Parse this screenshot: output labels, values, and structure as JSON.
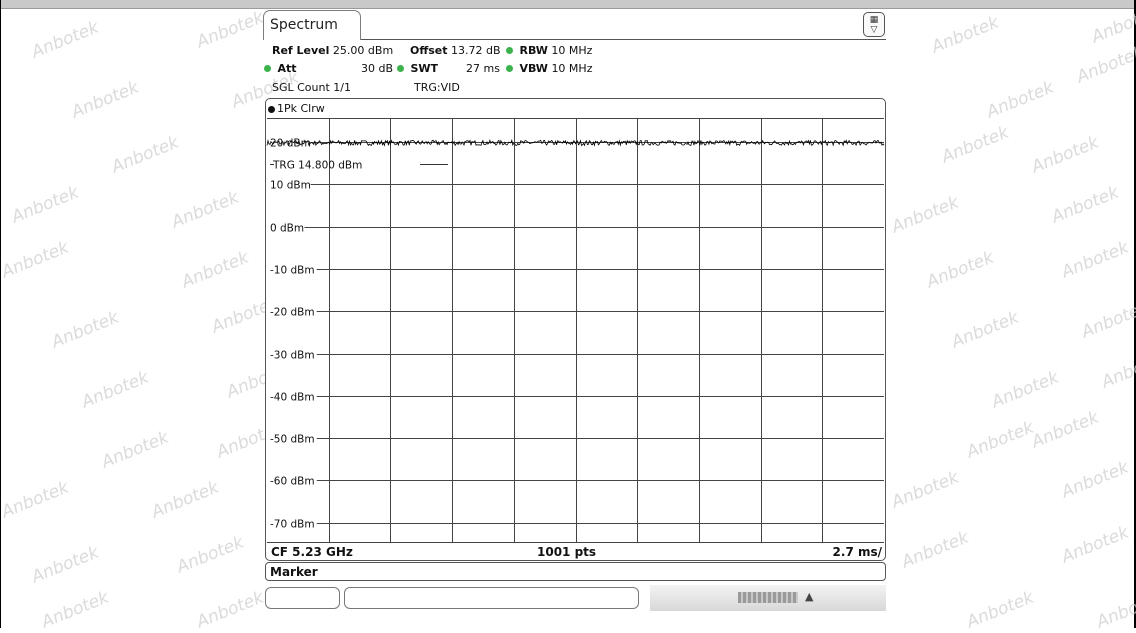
{
  "watermark_text": "Anbotek",
  "tab": {
    "label": "Spectrum"
  },
  "settings": {
    "ref_level_label": "Ref Level",
    "ref_level_value": "25.00 dBm",
    "offset_label": "Offset",
    "offset_value": "13.72 dB",
    "rbw_label": "RBW",
    "rbw_value": "10 MHz",
    "att_label": "Att",
    "att_value": "30 dB",
    "swt_label": "SWT",
    "swt_value": "27 ms",
    "vbw_label": "VBW",
    "vbw_value": "10 MHz",
    "sgl_count": "SGL Count 1/1",
    "trg": "TRG:VID"
  },
  "trace_label": "1Pk Clrw",
  "chart_data": {
    "type": "line",
    "ylim": [
      -80,
      25
    ],
    "y_ticks": [
      20,
      10,
      0,
      -10,
      -20,
      -30,
      -40,
      -50,
      -60,
      -70
    ],
    "y_tick_labels": [
      "20 dBm",
      "10 dBm",
      "0 dBm",
      "-10 dBm",
      "-20 dBm",
      "-30 dBm",
      "-40 dBm",
      "-50 dBm",
      "-60 dBm",
      "-70 dBm"
    ],
    "x_divisions": 10,
    "x_points": 1001,
    "series": [
      {
        "level_dbm": 19.8,
        "ripple_db": 0.6
      }
    ],
    "trigger_line": {
      "label": "TRG",
      "value_label": "14.800 dBm",
      "value": 14.8
    },
    "trace_color": "#000000",
    "grid": true
  },
  "bottom": {
    "cf": "CF 5.23 GHz",
    "pts": "1001 pts",
    "div": "2.7 ms/"
  },
  "marker_bar": "Marker"
}
